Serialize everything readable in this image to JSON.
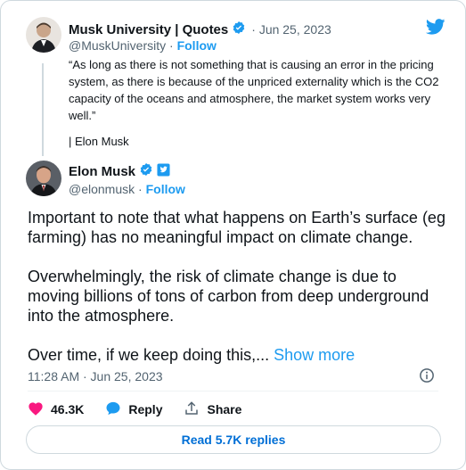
{
  "quoted_tweet": {
    "author_name": "Musk University | Quotes",
    "date": "Jun 25, 2023",
    "handle": "@MuskUniversity",
    "separator": "·",
    "follow_label": "Follow",
    "text": "“As long as there is not something that is causing an error in the pricing system, as there is because of the unpriced externality which is the CO2 capacity of the oceans and atmosphere, the market system works very well.”",
    "signature": "| Elon Musk"
  },
  "main_tweet": {
    "author_name": "Elon Musk",
    "handle": "@elonmusk",
    "separator": "·",
    "follow_label": "Follow",
    "paragraphs": [
      "Important to note that what happens on Earth’s surface (eg farming) has no meaningful impact on climate change.",
      "Overwhelmingly, the risk of climate change is due to moving billions of tons of carbon from deep underground into the atmosphere."
    ],
    "truncated_text": "Over time, if we keep doing this,...",
    "show_more_label": "Show more",
    "timestamp": "11:28 AM · Jun 25, 2023"
  },
  "actions": {
    "likes": "46.3K",
    "reply_label": "Reply",
    "share_label": "Share"
  },
  "read_replies_label": "Read 5.7K replies",
  "colors": {
    "accent": "#1d9bf0",
    "like": "#f91880",
    "muted": "#536471",
    "border": "#cfd9de"
  },
  "icons": [
    "twitter-bird-icon",
    "verified-badge-icon",
    "affiliate-badge-icon",
    "heart-icon",
    "reply-bubble-icon",
    "share-icon",
    "info-icon"
  ]
}
